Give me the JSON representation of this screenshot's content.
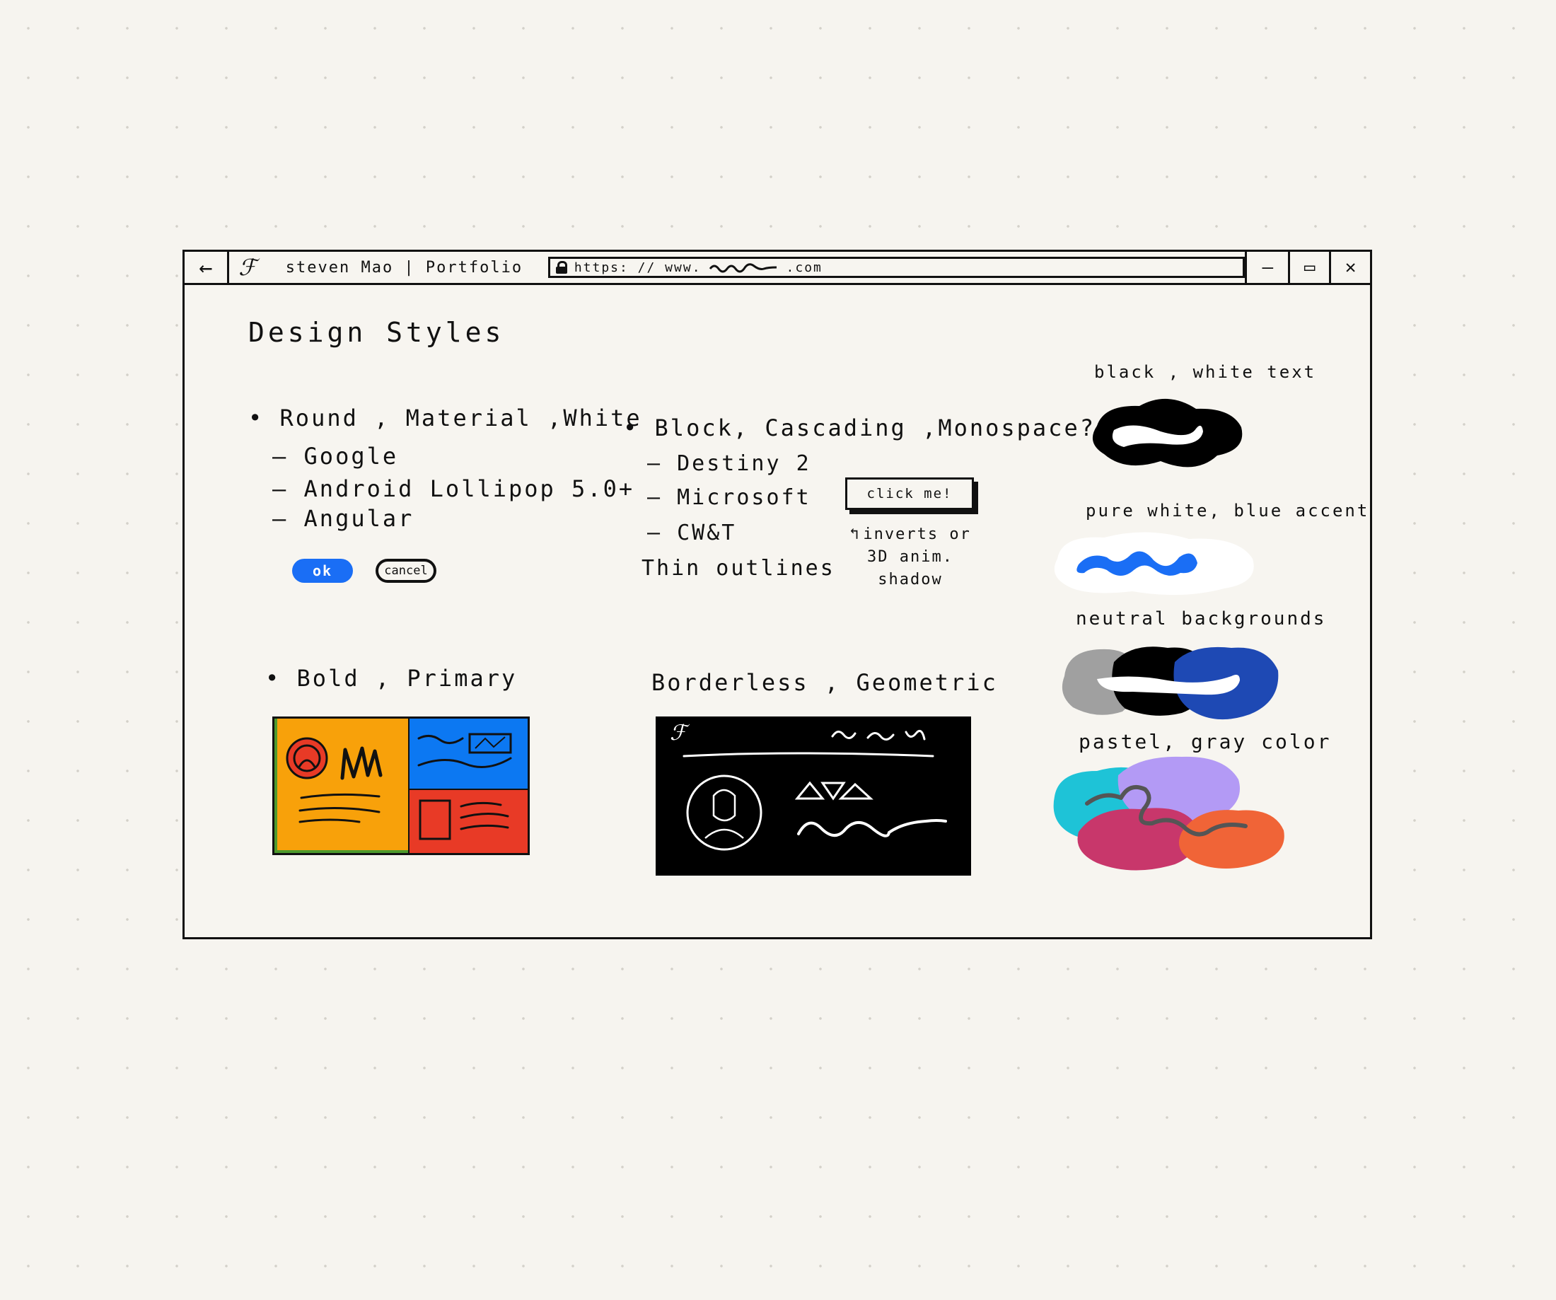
{
  "browser": {
    "back_icon": "arrow-left-icon",
    "logo_glyph": "ℱ",
    "tab_title": "steven Mao | Portfolio",
    "url": "https: // www.",
    "url_suffix": ".com",
    "controls": {
      "minimize": "–",
      "maximize": "▭",
      "close": "✕"
    }
  },
  "page": {
    "heading": "Design Styles",
    "round": {
      "title": "• Round , Material ,White",
      "items": [
        "– Google",
        "– Android Lollipop 5.0+",
        "– Angular"
      ],
      "ok_label": "ok",
      "cancel_label": "cancel"
    },
    "block": {
      "title": "• Block, Cascading ,Monospace?",
      "items": [
        "– Destiny 2",
        "– Microsoft",
        "– CW&T"
      ],
      "note": "Thin outlines",
      "button_label": "click me!",
      "annotation": [
        "inverts or",
        "3D anim.",
        "shadow"
      ]
    },
    "bold": {
      "title": "• Bold , Primary",
      "colors": {
        "orange": "#f8a10a",
        "blue": "#0c78f2",
        "red": "#e83a26",
        "green": "#4e9a2d"
      }
    },
    "geometric": {
      "title": "Borderless , Geometric",
      "logo_glyph": "ℱ"
    }
  },
  "palettes": [
    {
      "label": "black , white text",
      "colors": [
        "#000000",
        "#ffffff"
      ]
    },
    {
      "label": "pure white, blue accent",
      "colors": [
        "#ffffff",
        "#1a6ef5"
      ]
    },
    {
      "label": "neutral backgrounds",
      "colors": [
        "#a0a0a0",
        "#000000",
        "#1e49b4",
        "#ffffff"
      ]
    },
    {
      "label": "pastel, gray color",
      "colors": [
        "#1ec3d7",
        "#b39af5",
        "#c8376b",
        "#f06437",
        "#555555"
      ]
    }
  ]
}
